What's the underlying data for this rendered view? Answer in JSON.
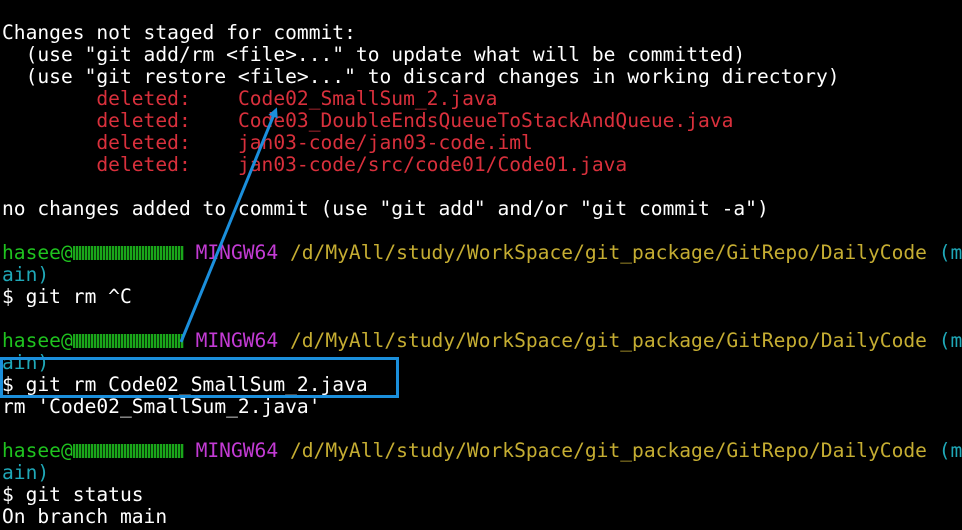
{
  "colors": {
    "background": "#000000",
    "text": "#ffffff",
    "deleted": "#d9303c",
    "user": "#1fc31f",
    "mingw": "#c33bd4",
    "path": "#c5ad32",
    "branch": "#1fa8b8",
    "annotation": "#1b8fdc"
  },
  "status_header": {
    "title": "Changes not staged for commit:",
    "hint1": "  (use \"git add/rm <file>...\" to update what will be committed)",
    "hint2": "  (use \"git restore <file>...\" to discard changes in working directory)"
  },
  "deleted_files": [
    {
      "status": "        deleted:    ",
      "file": "Code02_SmallSum_2.java"
    },
    {
      "status": "        deleted:    ",
      "file": "Code03_DoubleEndsQueueToStackAndQueue.java"
    },
    {
      "status": "        deleted:    ",
      "file": "jan03-code/jan03-code.iml"
    },
    {
      "status": "        deleted:    ",
      "file": "jan03-code/src/code01/Code01.java"
    }
  ],
  "no_changes_line": "no changes added to commit (use \"git add\" and/or \"git commit -a\")",
  "prompt": {
    "user": "hasee@",
    "mingw": "MINGW64",
    "path": "/d/MyAll/study/WorkSpace/git_package/GitRepo/DailyCode",
    "branch_part1": "(m",
    "branch_part2": "ain)"
  },
  "commands": {
    "cmd1": "$ git rm ^C",
    "cmd2": "$ git rm Code02_SmallSum_2.java",
    "cmd2_output": "rm 'Code02_SmallSum_2.java'",
    "cmd3": "$ git status",
    "cmd3_output": "On branch main"
  }
}
